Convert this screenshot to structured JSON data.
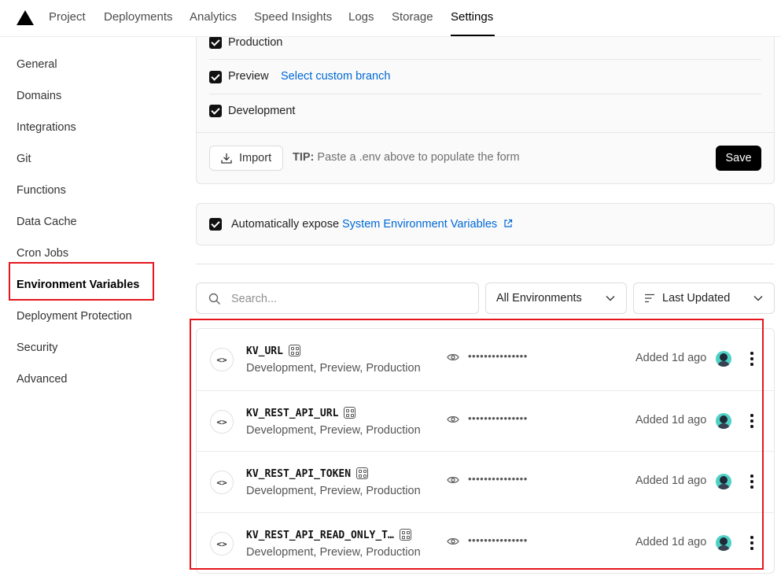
{
  "nav": {
    "tabs": [
      {
        "label": "Project"
      },
      {
        "label": "Deployments"
      },
      {
        "label": "Analytics"
      },
      {
        "label": "Speed Insights"
      },
      {
        "label": "Logs"
      },
      {
        "label": "Storage"
      },
      {
        "label": "Settings",
        "active": true
      }
    ]
  },
  "sidebar": {
    "items": [
      {
        "label": "General"
      },
      {
        "label": "Domains"
      },
      {
        "label": "Integrations"
      },
      {
        "label": "Git"
      },
      {
        "label": "Functions"
      },
      {
        "label": "Data Cache"
      },
      {
        "label": "Cron Jobs"
      },
      {
        "label": "Environment Variables",
        "active": true
      },
      {
        "label": "Deployment Protection"
      },
      {
        "label": "Security"
      },
      {
        "label": "Advanced"
      }
    ]
  },
  "environments": {
    "production_label": "Production",
    "preview_label": "Preview",
    "custom_branch_link": "Select custom branch",
    "development_label": "Development"
  },
  "import_bar": {
    "import_label": "Import",
    "tip_prefix": "TIP:",
    "tip_text": "Paste a .env above to populate the form",
    "save_label": "Save"
  },
  "auto_expose": {
    "prefix": "Automatically expose",
    "link": "System Environment Variables",
    "checked": true
  },
  "filters": {
    "search_placeholder": "Search...",
    "environment_select": "All Environments",
    "sort_select": "Last Updated"
  },
  "variables": [
    {
      "name": "KV_URL",
      "environments": "Development, Preview, Production",
      "masked": "•••••••••••••••",
      "added": "Added 1d ago"
    },
    {
      "name": "KV_REST_API_URL",
      "environments": "Development, Preview, Production",
      "masked": "•••••••••••••••",
      "added": "Added 1d ago"
    },
    {
      "name": "KV_REST_API_TOKEN",
      "environments": "Development, Preview, Production",
      "masked": "•••••••••••••••",
      "added": "Added 1d ago"
    },
    {
      "name": "KV_REST_API_READ_ONLY_T…",
      "environments": "Development, Preview, Production",
      "masked": "•••••••••••••••",
      "added": "Added 1d ago"
    }
  ],
  "colors": {
    "link": "#0068d6",
    "highlight": "#e5161c",
    "avatar": "#4fd1c5"
  }
}
